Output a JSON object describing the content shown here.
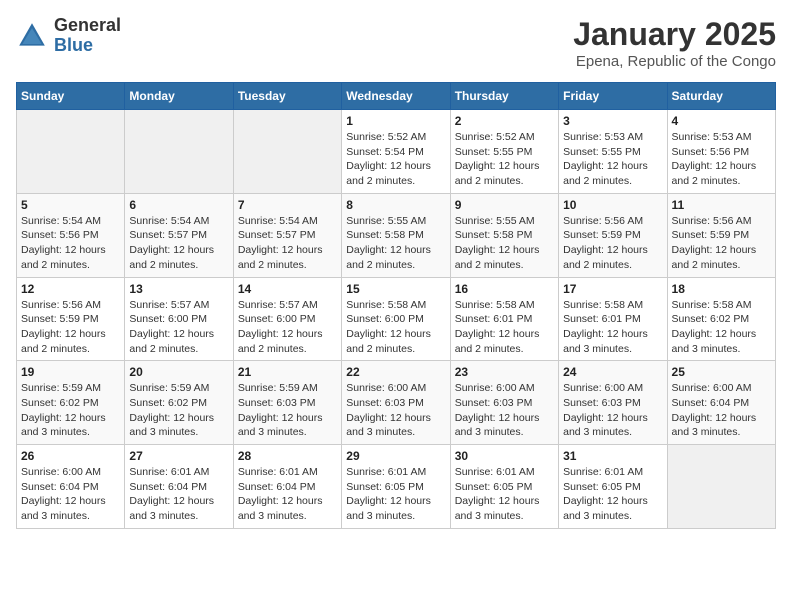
{
  "header": {
    "logo_general": "General",
    "logo_blue": "Blue",
    "title": "January 2025",
    "subtitle": "Epena, Republic of the Congo"
  },
  "days_of_week": [
    "Sunday",
    "Monday",
    "Tuesday",
    "Wednesday",
    "Thursday",
    "Friday",
    "Saturday"
  ],
  "weeks": [
    [
      {
        "day": "",
        "detail": ""
      },
      {
        "day": "",
        "detail": ""
      },
      {
        "day": "",
        "detail": ""
      },
      {
        "day": "1",
        "detail": "Sunrise: 5:52 AM\nSunset: 5:54 PM\nDaylight: 12 hours\nand 2 minutes."
      },
      {
        "day": "2",
        "detail": "Sunrise: 5:52 AM\nSunset: 5:55 PM\nDaylight: 12 hours\nand 2 minutes."
      },
      {
        "day": "3",
        "detail": "Sunrise: 5:53 AM\nSunset: 5:55 PM\nDaylight: 12 hours\nand 2 minutes."
      },
      {
        "day": "4",
        "detail": "Sunrise: 5:53 AM\nSunset: 5:56 PM\nDaylight: 12 hours\nand 2 minutes."
      }
    ],
    [
      {
        "day": "5",
        "detail": "Sunrise: 5:54 AM\nSunset: 5:56 PM\nDaylight: 12 hours\nand 2 minutes."
      },
      {
        "day": "6",
        "detail": "Sunrise: 5:54 AM\nSunset: 5:57 PM\nDaylight: 12 hours\nand 2 minutes."
      },
      {
        "day": "7",
        "detail": "Sunrise: 5:54 AM\nSunset: 5:57 PM\nDaylight: 12 hours\nand 2 minutes."
      },
      {
        "day": "8",
        "detail": "Sunrise: 5:55 AM\nSunset: 5:58 PM\nDaylight: 12 hours\nand 2 minutes."
      },
      {
        "day": "9",
        "detail": "Sunrise: 5:55 AM\nSunset: 5:58 PM\nDaylight: 12 hours\nand 2 minutes."
      },
      {
        "day": "10",
        "detail": "Sunrise: 5:56 AM\nSunset: 5:59 PM\nDaylight: 12 hours\nand 2 minutes."
      },
      {
        "day": "11",
        "detail": "Sunrise: 5:56 AM\nSunset: 5:59 PM\nDaylight: 12 hours\nand 2 minutes."
      }
    ],
    [
      {
        "day": "12",
        "detail": "Sunrise: 5:56 AM\nSunset: 5:59 PM\nDaylight: 12 hours\nand 2 minutes."
      },
      {
        "day": "13",
        "detail": "Sunrise: 5:57 AM\nSunset: 6:00 PM\nDaylight: 12 hours\nand 2 minutes."
      },
      {
        "day": "14",
        "detail": "Sunrise: 5:57 AM\nSunset: 6:00 PM\nDaylight: 12 hours\nand 2 minutes."
      },
      {
        "day": "15",
        "detail": "Sunrise: 5:58 AM\nSunset: 6:00 PM\nDaylight: 12 hours\nand 2 minutes."
      },
      {
        "day": "16",
        "detail": "Sunrise: 5:58 AM\nSunset: 6:01 PM\nDaylight: 12 hours\nand 2 minutes."
      },
      {
        "day": "17",
        "detail": "Sunrise: 5:58 AM\nSunset: 6:01 PM\nDaylight: 12 hours\nand 3 minutes."
      },
      {
        "day": "18",
        "detail": "Sunrise: 5:58 AM\nSunset: 6:02 PM\nDaylight: 12 hours\nand 3 minutes."
      }
    ],
    [
      {
        "day": "19",
        "detail": "Sunrise: 5:59 AM\nSunset: 6:02 PM\nDaylight: 12 hours\nand 3 minutes."
      },
      {
        "day": "20",
        "detail": "Sunrise: 5:59 AM\nSunset: 6:02 PM\nDaylight: 12 hours\nand 3 minutes."
      },
      {
        "day": "21",
        "detail": "Sunrise: 5:59 AM\nSunset: 6:03 PM\nDaylight: 12 hours\nand 3 minutes."
      },
      {
        "day": "22",
        "detail": "Sunrise: 6:00 AM\nSunset: 6:03 PM\nDaylight: 12 hours\nand 3 minutes."
      },
      {
        "day": "23",
        "detail": "Sunrise: 6:00 AM\nSunset: 6:03 PM\nDaylight: 12 hours\nand 3 minutes."
      },
      {
        "day": "24",
        "detail": "Sunrise: 6:00 AM\nSunset: 6:03 PM\nDaylight: 12 hours\nand 3 minutes."
      },
      {
        "day": "25",
        "detail": "Sunrise: 6:00 AM\nSunset: 6:04 PM\nDaylight: 12 hours\nand 3 minutes."
      }
    ],
    [
      {
        "day": "26",
        "detail": "Sunrise: 6:00 AM\nSunset: 6:04 PM\nDaylight: 12 hours\nand 3 minutes."
      },
      {
        "day": "27",
        "detail": "Sunrise: 6:01 AM\nSunset: 6:04 PM\nDaylight: 12 hours\nand 3 minutes."
      },
      {
        "day": "28",
        "detail": "Sunrise: 6:01 AM\nSunset: 6:04 PM\nDaylight: 12 hours\nand 3 minutes."
      },
      {
        "day": "29",
        "detail": "Sunrise: 6:01 AM\nSunset: 6:05 PM\nDaylight: 12 hours\nand 3 minutes."
      },
      {
        "day": "30",
        "detail": "Sunrise: 6:01 AM\nSunset: 6:05 PM\nDaylight: 12 hours\nand 3 minutes."
      },
      {
        "day": "31",
        "detail": "Sunrise: 6:01 AM\nSunset: 6:05 PM\nDaylight: 12 hours\nand 3 minutes."
      },
      {
        "day": "",
        "detail": ""
      }
    ]
  ]
}
